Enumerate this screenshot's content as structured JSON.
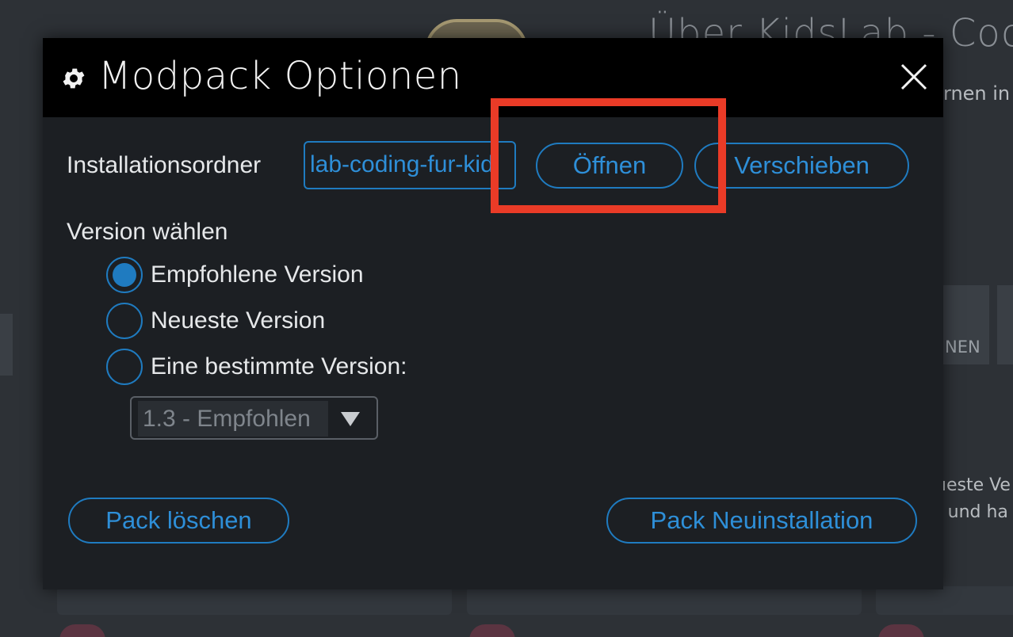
{
  "background": {
    "title": "Über KidsLab - Coo",
    "subtitle": "rnen in",
    "tile_label": "NEN",
    "desc_line1": "ueste Ve",
    "desc_line2": "t und ha"
  },
  "modal": {
    "title": "Modpack Optionen",
    "gear_icon": "gear-icon",
    "close_icon": "close-icon",
    "install_folder_label": "Installationsordner",
    "install_path_value": "lab-coding-fur-kid",
    "open_button": "Öffnen",
    "move_button": "Verschieben",
    "version_label": "Version wählen",
    "radios": [
      {
        "label": "Empfohlene Version",
        "checked": true
      },
      {
        "label": "Neueste Version",
        "checked": false
      },
      {
        "label": "Eine bestimmte Version:",
        "checked": false
      }
    ],
    "version_select": {
      "value": "1.3 - Empfohlen",
      "disabled": true
    },
    "delete_button": "Pack löschen",
    "reinstall_button": "Pack Neuinstallation"
  },
  "colors": {
    "accent": "#1f7bc0",
    "highlight": "#ea3b27",
    "modal_bg": "#1c1f23",
    "header_bg": "#000000"
  }
}
